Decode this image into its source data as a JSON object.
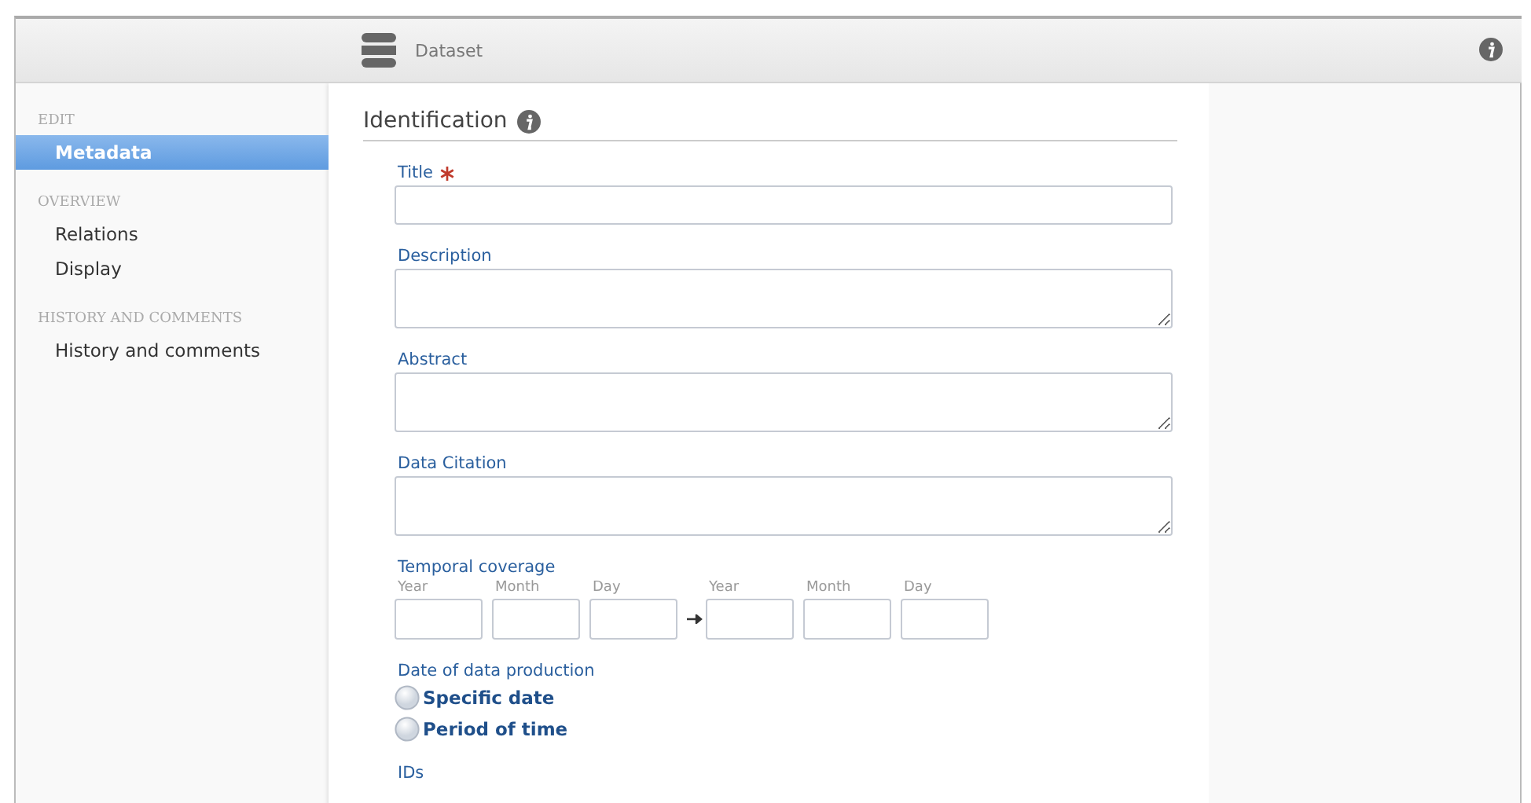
{
  "header": {
    "title": "Dataset"
  },
  "sidebar": {
    "sections": [
      {
        "heading": "EDIT",
        "items": [
          {
            "label": "Metadata",
            "selected": true
          }
        ]
      },
      {
        "heading": "OVERVIEW",
        "items": [
          {
            "label": "Relations",
            "selected": false
          },
          {
            "label": "Display",
            "selected": false
          }
        ]
      },
      {
        "heading": "HISTORY AND COMMENTS",
        "items": [
          {
            "label": "History and comments",
            "selected": false
          }
        ]
      }
    ]
  },
  "form": {
    "heading": "Identification",
    "fields": [
      {
        "kind": "text",
        "label": "Title",
        "required": true
      },
      {
        "kind": "textarea",
        "label": "Description",
        "required": false
      },
      {
        "kind": "textarea",
        "label": "Abstract",
        "required": false
      },
      {
        "kind": "textarea",
        "label": "Data Citation",
        "required": false
      },
      {
        "kind": "date_range",
        "label": "Temporal coverage",
        "parts": [
          "Year",
          "Month",
          "Day"
        ],
        "end_parts": [
          "Year",
          "Month",
          "Day"
        ]
      },
      {
        "kind": "radio",
        "label": "Date of data production",
        "options": [
          {
            "label": "Specific date",
            "selected": false
          },
          {
            "label": "Period of time",
            "selected": false
          }
        ]
      },
      {
        "kind": "section",
        "label": "IDs"
      }
    ]
  }
}
